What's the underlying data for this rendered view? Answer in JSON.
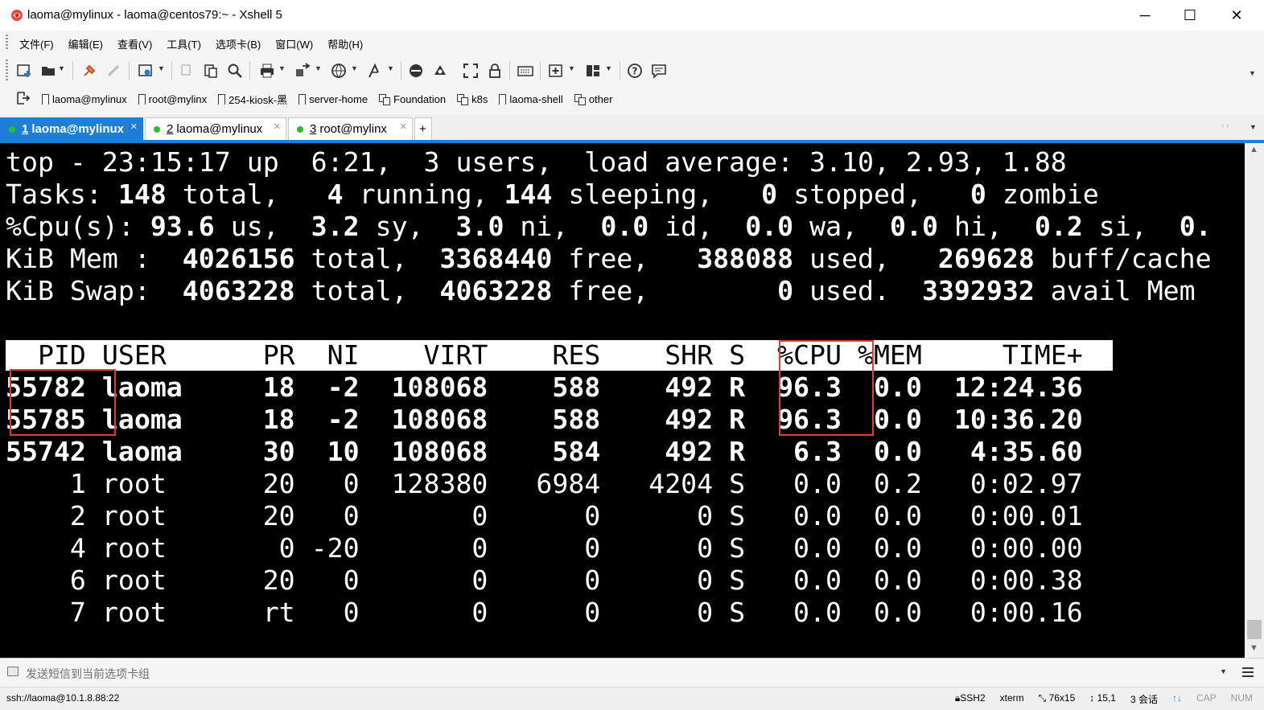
{
  "window": {
    "title": "laoma@mylinux - laoma@centos79:~ - Xshell 5",
    "minimize": "─",
    "maximize": "☐",
    "close": "✕"
  },
  "menu": [
    "文件(F)",
    "编辑(E)",
    "查看(V)",
    "工具(T)",
    "选项卡(B)",
    "窗口(W)",
    "帮助(H)"
  ],
  "links": [
    {
      "label": "laoma@mylinux",
      "icon": "bookmark-icon"
    },
    {
      "label": "root@mylinx",
      "icon": "bookmark-icon"
    },
    {
      "label": "254-kiosk-黑",
      "icon": "bookmark-icon"
    },
    {
      "label": "server-home",
      "icon": "bookmark-icon"
    },
    {
      "label": "Foundation",
      "icon": "session-group-icon"
    },
    {
      "label": "k8s",
      "icon": "session-group-icon"
    },
    {
      "label": "laoma-shell",
      "icon": "bookmark-icon"
    },
    {
      "label": "other",
      "icon": "session-group-icon"
    }
  ],
  "tabs": [
    {
      "num": "1",
      "label": "laoma@mylinux",
      "active": true
    },
    {
      "num": "2",
      "label": "laoma@mylinux",
      "active": false
    },
    {
      "num": "3",
      "label": "root@mylinx",
      "active": false
    }
  ],
  "tab_add": "+",
  "terminal": {
    "summary": [
      "top - 23:15:17 up  6:21,  3 users,  load average: 3.10, 2.93, 1.88",
      "Tasks: 148 total,   4 running, 144 sleeping,   0 stopped,   0 zombie",
      "%Cpu(s): 93.6 us,  3.2 sy,  3.0 ni,  0.0 id,  0.0 wa,  0.0 hi,  0.2 si,  0.",
      "KiB Mem :  4026156 total,  3368440 free,   388088 used,   269628 buff/cache",
      "KiB Swap:  4063228 total,  4063228 free,        0 used.  3392932 avail Mem"
    ],
    "header": "  PID USER      PR  NI    VIRT    RES    SHR S  %CPU %MEM     TIME+",
    "processes": [
      {
        "pid": "55782",
        "user": "laoma",
        "pr": "18",
        "ni": "-2",
        "virt": "108068",
        "res": "588",
        "shr": "492",
        "s": "R",
        "cpu": "96.3",
        "mem": "0.0",
        "time": "12:24.36",
        "bold": true
      },
      {
        "pid": "55785",
        "user": "laoma",
        "pr": "18",
        "ni": "-2",
        "virt": "108068",
        "res": "588",
        "shr": "492",
        "s": "R",
        "cpu": "96.3",
        "mem": "0.0",
        "time": "10:36.20",
        "bold": true
      },
      {
        "pid": "55742",
        "user": "laoma",
        "pr": "30",
        "ni": "10",
        "virt": "108068",
        "res": "584",
        "shr": "492",
        "s": "R",
        "cpu": "6.3",
        "mem": "0.0",
        "time": "4:35.60",
        "bold": true
      },
      {
        "pid": "1",
        "user": "root",
        "pr": "20",
        "ni": "0",
        "virt": "128380",
        "res": "6984",
        "shr": "4204",
        "s": "S",
        "cpu": "0.0",
        "mem": "0.2",
        "time": "0:02.97",
        "bold": false
      },
      {
        "pid": "2",
        "user": "root",
        "pr": "20",
        "ni": "0",
        "virt": "0",
        "res": "0",
        "shr": "0",
        "s": "S",
        "cpu": "0.0",
        "mem": "0.0",
        "time": "0:00.01",
        "bold": false
      },
      {
        "pid": "4",
        "user": "root",
        "pr": "0",
        "ni": "-20",
        "virt": "0",
        "res": "0",
        "shr": "0",
        "s": "S",
        "cpu": "0.0",
        "mem": "0.0",
        "time": "0:00.00",
        "bold": false
      },
      {
        "pid": "6",
        "user": "root",
        "pr": "20",
        "ni": "0",
        "virt": "0",
        "res": "0",
        "shr": "0",
        "s": "S",
        "cpu": "0.0",
        "mem": "0.0",
        "time": "0:00.38",
        "bold": false
      },
      {
        "pid": "7",
        "user": "root",
        "pr": "rt",
        "ni": "0",
        "virt": "0",
        "res": "0",
        "shr": "0",
        "s": "S",
        "cpu": "0.0",
        "mem": "0.0",
        "time": "0:00.16",
        "bold": false
      }
    ]
  },
  "compose": {
    "placeholder": "发送短信到当前选项卡组"
  },
  "status": {
    "connection": "ssh://laoma@10.1.8.88:22",
    "protocol": "SSH2",
    "terminal_type": "xterm",
    "size": "76x15",
    "cursor": "15,1",
    "sessions": "3 会话",
    "cap": "CAP",
    "num": "NUM"
  },
  "colors": {
    "accent": "#1e7fd6",
    "terminal_bg": "#000000",
    "terminal_fg": "#ffffff",
    "highlight": "#e53935",
    "session_dot": "#2ebd2e"
  }
}
